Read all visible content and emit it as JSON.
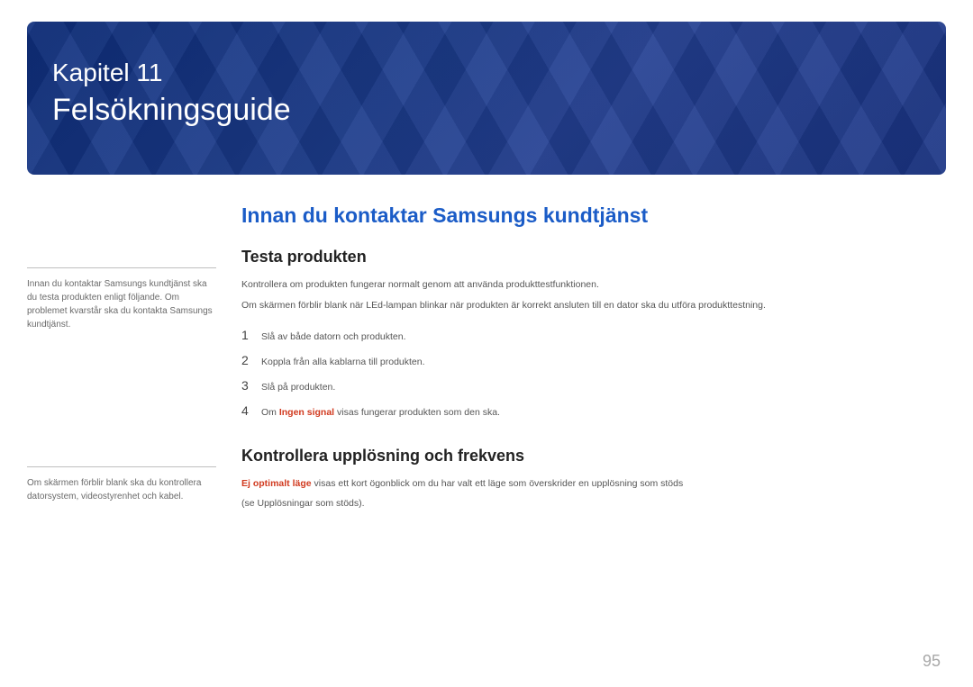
{
  "banner": {
    "chapter_label": "Kapitel 11",
    "title": "Felsökningsguide"
  },
  "sidebar": {
    "note1": "Innan du kontaktar Samsungs kundtjänst ska du testa produkten enligt följande. Om problemet kvarstår ska du kontakta Samsungs kundtjänst.",
    "note2": "Om skärmen förblir blank ska du kontrollera datorsystem, videostyrenhet och kabel."
  },
  "main": {
    "section_title": "Innan du kontaktar Samsungs kundtjänst",
    "sub1": {
      "heading": "Testa produkten",
      "p1": "Kontrollera om produkten fungerar normalt genom att använda produkttestfunktionen.",
      "p2": "Om skärmen förblir blank när LEd-lampan blinkar när produkten är korrekt ansluten till en dator ska du utföra produkttestning.",
      "steps": [
        {
          "n": "1",
          "text": "Slå av både datorn och produkten."
        },
        {
          "n": "2",
          "text": "Koppla från alla kablarna till produkten."
        },
        {
          "n": "3",
          "text": "Slå på produkten."
        },
        {
          "n": "4",
          "prefix": "Om ",
          "highlight": "Ingen signal",
          "suffix": " visas fungerar produkten som den ska."
        }
      ]
    },
    "sub2": {
      "heading": "Kontrollera upplösning och frekvens",
      "p_prefix": "",
      "p_highlight": "Ej optimalt läge",
      "p_suffix": " visas ett kort ögonblick om du har valt ett läge som överskrider en upplösning som stöds",
      "p2": "(se Upplösningar som stöds)."
    }
  },
  "page_number": "95"
}
